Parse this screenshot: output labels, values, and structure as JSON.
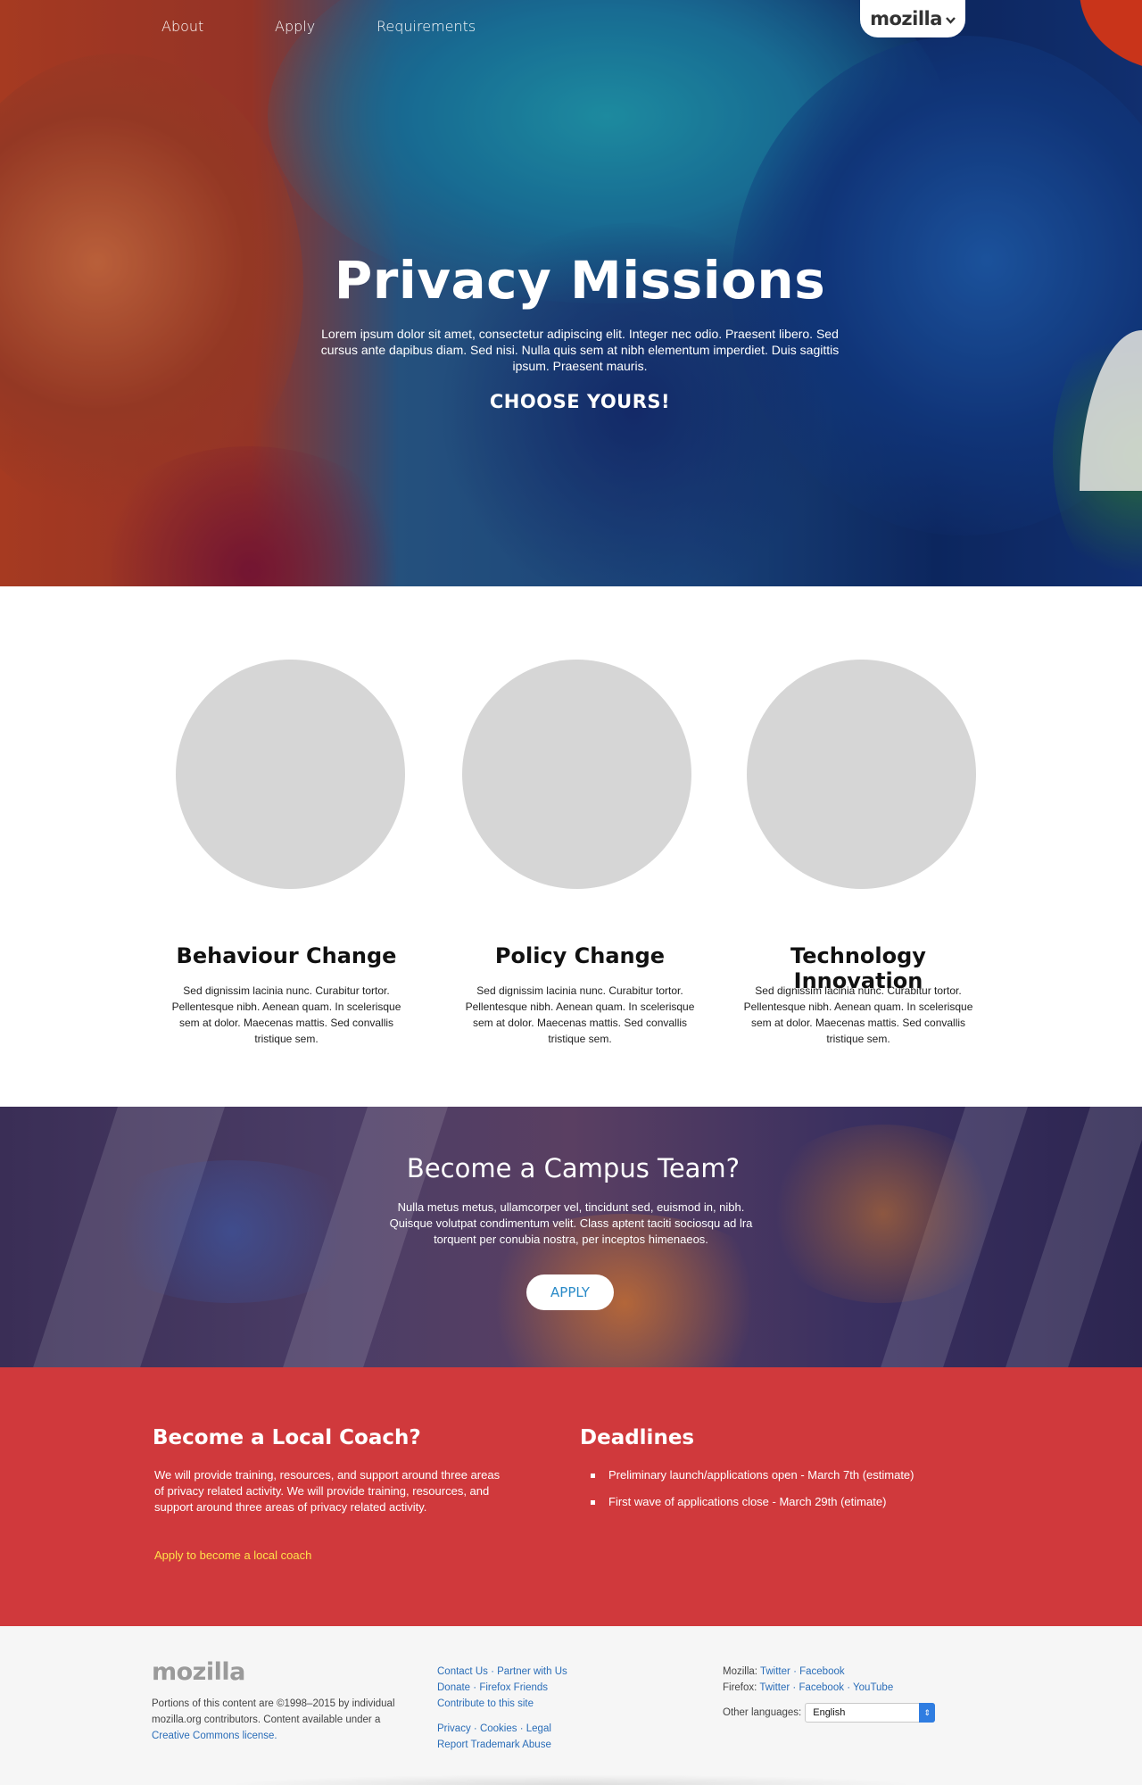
{
  "nav": {
    "items": [
      {
        "label": "About"
      },
      {
        "label": "Apply"
      },
      {
        "label": "Requirements"
      }
    ],
    "brand": "mozilla",
    "brand_chevron": "chevron-down-icon"
  },
  "hero": {
    "title": "Privacy Missions",
    "text": "Lorem ipsum dolor sit amet, consectetur adipiscing elit. Integer nec odio. Praesent libero. Sed cursus ante dapibus diam. Sed nisi. Nulla quis sem at nibh elementum imperdiet. Duis sagittis ipsum. Praesent mauris.",
    "cta": "CHOOSE YOURS!"
  },
  "features": [
    {
      "title": "Behaviour Change",
      "text": "Sed dignissim lacinia nunc. Curabitur tortor. Pellentesque nibh. Aenean quam. In scelerisque sem at dolor. Maecenas mattis. Sed convallis tristique sem."
    },
    {
      "title": "Policy Change",
      "text": "Sed dignissim lacinia nunc. Curabitur tortor. Pellentesque nibh. Aenean quam. In scelerisque sem at dolor. Maecenas mattis. Sed convallis tristique sem."
    },
    {
      "title": "Technology Innovation",
      "text": "Sed dignissim lacinia nunc. Curabitur tortor. Pellentesque nibh. Aenean quam. In scelerisque sem at dolor. Maecenas mattis. Sed convallis tristique sem."
    }
  ],
  "campus": {
    "title": "Become a Campus Team?",
    "text": "Nulla metus metus, ullamcorper vel, tincidunt sed, euismod in, nibh. Quisque volutpat condimentum velit. Class aptent taciti sociosqu ad lra torquent per conubia nostra, per inceptos himenaeos.",
    "button": "APPLY"
  },
  "coach": {
    "title": "Become a Local Coach?",
    "text": "We will provide training, resources, and support around three areas of privacy related activity. We will provide training, resources, and support around three areas of privacy related activity.",
    "link": "Apply to become a local coach"
  },
  "deadlines": {
    "title": "Deadlines",
    "items": [
      "Preliminary launch/applications open - March 7th (estimate)",
      "First wave of applications close - March 29th (etimate)"
    ]
  },
  "footer": {
    "logo": "mozilla",
    "legal_prefix": "Portions of this content are ©1998–2015 by individual mozilla.org contributors. Content available under a ",
    "legal_link": "Creative Commons license.",
    "links": {
      "contact": "Contact Us",
      "partner": "Partner with Us",
      "donate": "Donate",
      "friends": "Firefox Friends",
      "contribute": "Contribute to this site",
      "privacy": "Privacy",
      "cookies": "Cookies",
      "legal": "Legal",
      "trademark": "Report Trademark Abuse"
    },
    "social": {
      "mozilla_label": "Mozilla:",
      "firefox_label": "Firefox:",
      "twitter": "Twitter",
      "facebook": "Facebook",
      "youtube": "YouTube"
    },
    "languages": {
      "label": "Other languages:",
      "selected": "English"
    }
  },
  "colors": {
    "accent_red": "#d0393c",
    "link_blue": "#2a6db8",
    "coach_link_yellow": "#ffe14a",
    "placeholder_gray": "#d6d6d6"
  }
}
